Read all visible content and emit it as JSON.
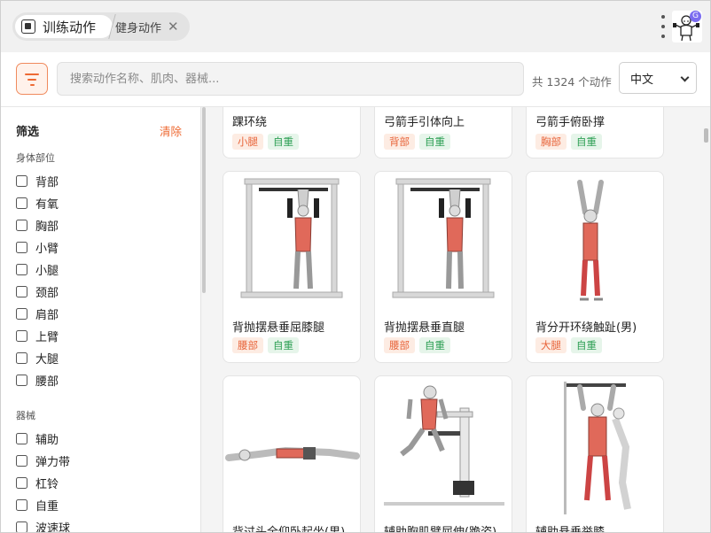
{
  "tabs": {
    "app_title": "训练动作",
    "second_tab": "健身动作",
    "close_glyph": "✕"
  },
  "search": {
    "placeholder": "搜索动作名称、肌肉、器械...",
    "count_text": "共 1324 个动作",
    "language": "中文"
  },
  "sidebar": {
    "title": "筛选",
    "clear": "清除",
    "body_section": "身体部位",
    "body_parts": [
      "背部",
      "有氧",
      "胸部",
      "小臂",
      "小腿",
      "颈部",
      "肩部",
      "上臂",
      "大腿",
      "腰部"
    ],
    "equipment_section": "器械",
    "equipment": [
      "辅助",
      "弹力带",
      "杠铃",
      "自重",
      "波速球"
    ]
  },
  "cards": [
    {
      "title": "踝环绕",
      "muscle": "小腿",
      "equipment": "自重"
    },
    {
      "title": "弓箭手引体向上",
      "muscle": "背部",
      "equipment": "自重"
    },
    {
      "title": "弓箭手俯卧撑",
      "muscle": "胸部",
      "equipment": "自重"
    },
    {
      "title": "背抛摆悬垂屈膝腿",
      "muscle": "腰部",
      "equipment": "自重"
    },
    {
      "title": "背抛摆悬垂直腿",
      "muscle": "腰部",
      "equipment": "自重"
    },
    {
      "title": "背分开环绕触趾(男)",
      "muscle": "大腿",
      "equipment": "自重"
    },
    {
      "title": "背过头全仰卧起坐(男)",
      "muscle": "",
      "equipment": ""
    },
    {
      "title": "辅助胸肌臂屈伸(跪姿)",
      "muscle": "",
      "equipment": ""
    },
    {
      "title": "辅助悬垂举膝",
      "muscle": "",
      "equipment": ""
    }
  ],
  "colors": {
    "accent": "#ee6a33",
    "equipment_tag": "#2ea055"
  }
}
